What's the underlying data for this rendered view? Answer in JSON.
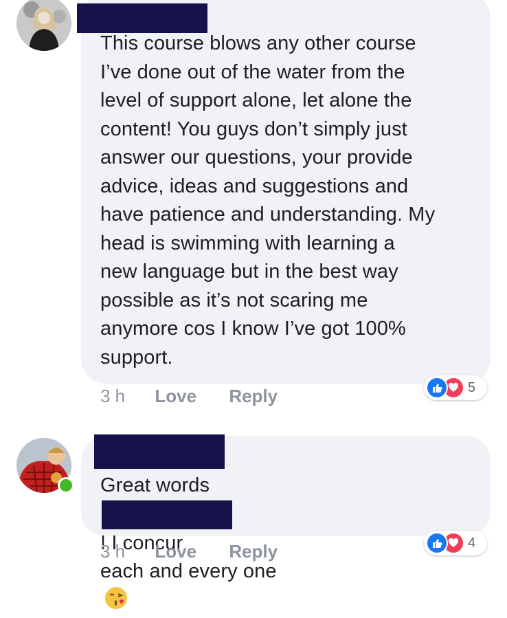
{
  "comments": [
    {
      "text_lines": [
        "This course blows any other course",
        "I’ve done out of the water from the",
        "level of support alone, let alone the",
        "content! You guys don’t simply just",
        "answer our questions, your provide",
        "advice, ideas and suggestions and",
        "have patience and understanding. My",
        "head is swimming with learning a",
        "new language but in the best way",
        "possible as it’s not scaring me",
        "anymore cos I know I’ve got 100%",
        "support."
      ],
      "time": "3 h",
      "love_label": "Love",
      "reply_label": "Reply",
      "reaction_count": "5"
    },
    {
      "text_part1": "Great words",
      "text_part2": "! I concur",
      "text_line2": "each and every one",
      "time": "3 h",
      "love_label": "Love",
      "reply_label": "Reply",
      "reaction_count": "4"
    }
  ],
  "icons": {
    "like": "thumbs-up-icon",
    "love": "heart-icon",
    "emoji": "kissing-face-emoji"
  },
  "colors": {
    "bubble": "#f0f2f5",
    "redaction": "#15124a",
    "like": "#1877f2",
    "love": "#f33e58",
    "online": "#42b72a"
  }
}
